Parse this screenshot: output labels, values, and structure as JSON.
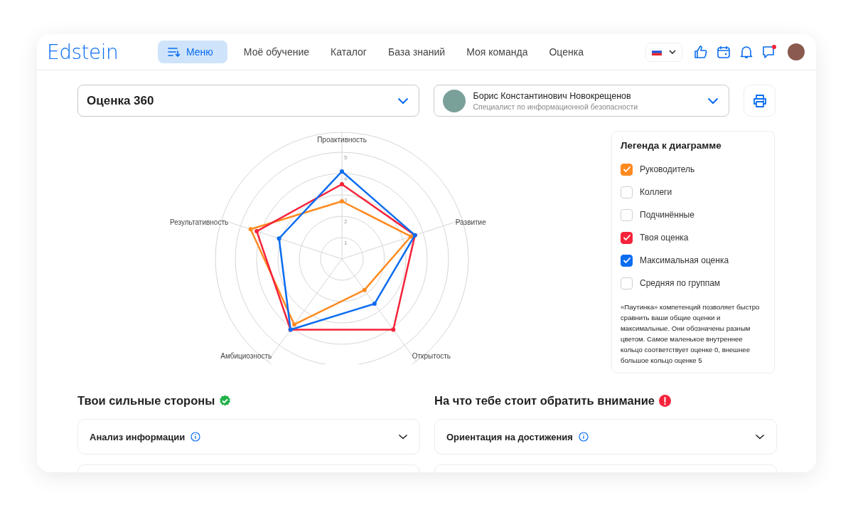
{
  "header": {
    "logo": "Edstein",
    "menu_button": "Меню",
    "nav": [
      {
        "label": "Моё обучение",
        "selected": false
      },
      {
        "label": "Каталог",
        "selected": false
      },
      {
        "label": "База знаний",
        "selected": false
      },
      {
        "label": "Моя команда",
        "selected": false
      },
      {
        "label": "Оценка",
        "selected": false
      }
    ],
    "chat_unread": true
  },
  "assessment_select": {
    "value": "Оценка 360"
  },
  "person_select": {
    "name": "Борис Константинович Новокрещенов",
    "position": "Специалист по информационной безопасности"
  },
  "chart": {
    "axis_labels": [
      "Проактивность",
      "Развитие",
      "Открытость",
      "Амбициозность",
      "Результативность"
    ],
    "ring_labels": [
      "5",
      "4",
      "3",
      "2",
      "1"
    ]
  },
  "legend": {
    "title": "Легенда к диаграмме",
    "items": [
      {
        "label": "Руководитель",
        "checked": true,
        "color": "#ff8a1f"
      },
      {
        "label": "Коллеги",
        "checked": false
      },
      {
        "label": "Подчинённые",
        "checked": false
      },
      {
        "label": "Твоя оценка",
        "checked": true,
        "color": "#f5233a"
      },
      {
        "label": "Максимальная оценка",
        "checked": true,
        "color": "#0a6cf0"
      },
      {
        "label": "Средняя по группам",
        "checked": false
      }
    ],
    "note": "«Паутинка» компетенций позволяет быстро сравнить ваши общие оценки и максимальные. Они обозначены разным цветом. Самое маленькое внутреннее кольцо соответствует оценке 0, внешнее большое кольцо оценке 5"
  },
  "sections": [
    {
      "kind": "strengths",
      "title": "Твои сильные стороны",
      "items": [
        {
          "label": "Анализ информации",
          "expanded": false
        }
      ]
    },
    {
      "kind": "attention",
      "title": "На что тебе стоит обратить внимание",
      "items": [
        {
          "label": "Ориентация на достижения",
          "expanded": false
        }
      ]
    }
  ]
}
